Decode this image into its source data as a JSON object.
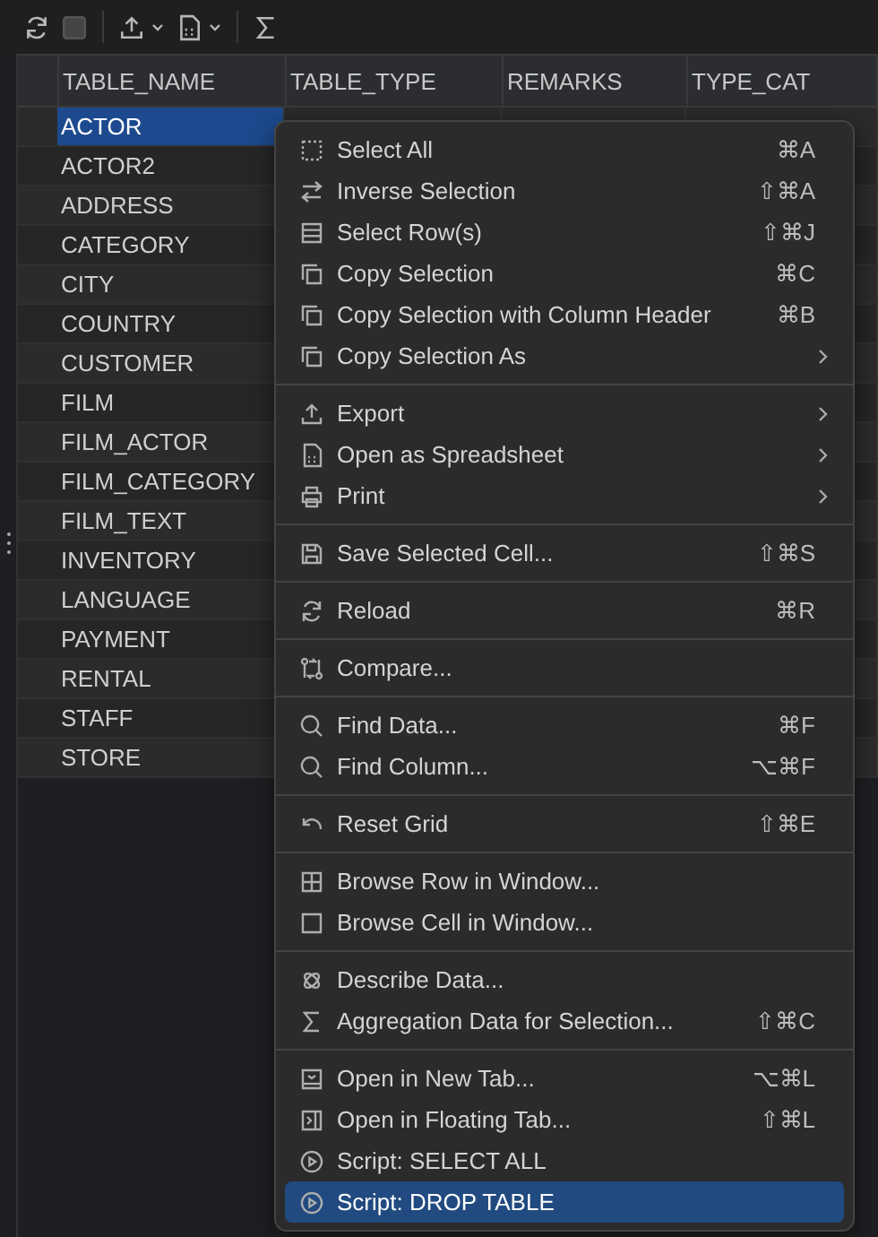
{
  "table": {
    "columns": [
      "TABLE_NAME",
      "TABLE_TYPE",
      "REMARKS",
      "TYPE_CAT"
    ],
    "rows": [
      {
        "table_name": "ACTOR",
        "selected": true
      },
      {
        "table_name": "ACTOR2",
        "selected": false
      },
      {
        "table_name": "ADDRESS",
        "selected": false
      },
      {
        "table_name": "CATEGORY",
        "selected": false
      },
      {
        "table_name": "CITY",
        "selected": false
      },
      {
        "table_name": "COUNTRY",
        "selected": false
      },
      {
        "table_name": "CUSTOMER",
        "selected": false
      },
      {
        "table_name": "FILM",
        "selected": false
      },
      {
        "table_name": "FILM_ACTOR",
        "selected": false
      },
      {
        "table_name": "FILM_CATEGORY",
        "selected": false
      },
      {
        "table_name": "FILM_TEXT",
        "selected": false
      },
      {
        "table_name": "INVENTORY",
        "selected": false
      },
      {
        "table_name": "LANGUAGE",
        "selected": false
      },
      {
        "table_name": "PAYMENT",
        "selected": false
      },
      {
        "table_name": "RENTAL",
        "selected": false
      },
      {
        "table_name": "STAFF",
        "selected": false
      },
      {
        "table_name": "STORE",
        "selected": false
      }
    ]
  },
  "context_menu": {
    "groups": [
      {
        "items": [
          {
            "label": "Select All",
            "shortcut": "⌘A",
            "submenu": false,
            "selected": false
          },
          {
            "label": "Inverse Selection",
            "shortcut": "⇧⌘A",
            "submenu": false,
            "selected": false
          },
          {
            "label": "Select Row(s)",
            "shortcut": "⇧⌘J",
            "submenu": false,
            "selected": false
          },
          {
            "label": "Copy Selection",
            "shortcut": "⌘C",
            "submenu": false,
            "selected": false
          },
          {
            "label": "Copy Selection with Column Header",
            "shortcut": "⌘B",
            "submenu": false,
            "selected": false
          },
          {
            "label": "Copy Selection As",
            "submenu": true,
            "selected": false
          }
        ]
      },
      {
        "items": [
          {
            "label": "Export",
            "submenu": true,
            "selected": false
          },
          {
            "label": "Open as Spreadsheet",
            "submenu": true,
            "selected": false
          },
          {
            "label": "Print",
            "submenu": true,
            "selected": false
          }
        ]
      },
      {
        "items": [
          {
            "label": "Save Selected Cell...",
            "shortcut": "⇧⌘S",
            "submenu": false,
            "selected": false
          }
        ]
      },
      {
        "items": [
          {
            "label": "Reload",
            "shortcut": "⌘R",
            "submenu": false,
            "selected": false
          }
        ]
      },
      {
        "items": [
          {
            "label": "Compare...",
            "submenu": false,
            "selected": false
          }
        ]
      },
      {
        "items": [
          {
            "label": "Find Data...",
            "shortcut": "⌘F",
            "submenu": false,
            "selected": false
          },
          {
            "label": "Find Column...",
            "shortcut": "⌥⌘F",
            "submenu": false,
            "selected": false
          }
        ]
      },
      {
        "items": [
          {
            "label": "Reset Grid",
            "shortcut": "⇧⌘E",
            "submenu": false,
            "selected": false
          }
        ]
      },
      {
        "items": [
          {
            "label": "Browse Row in Window...",
            "submenu": false,
            "selected": false
          },
          {
            "label": "Browse Cell in Window...",
            "submenu": false,
            "selected": false
          }
        ]
      },
      {
        "items": [
          {
            "label": "Describe Data...",
            "submenu": false,
            "selected": false
          },
          {
            "label": "Aggregation Data for Selection...",
            "shortcut": "⇧⌘C",
            "submenu": false,
            "selected": false
          }
        ]
      },
      {
        "items": [
          {
            "label": "Open in New Tab...",
            "shortcut": "⌥⌘L",
            "submenu": false,
            "selected": false
          },
          {
            "label": "Open in Floating Tab...",
            "shortcut": "⇧⌘L",
            "submenu": false,
            "selected": false
          },
          {
            "label": "Script: SELECT ALL",
            "submenu": false,
            "selected": false
          },
          {
            "label": "Script: DROP TABLE",
            "submenu": false,
            "selected": true
          }
        ]
      }
    ]
  }
}
